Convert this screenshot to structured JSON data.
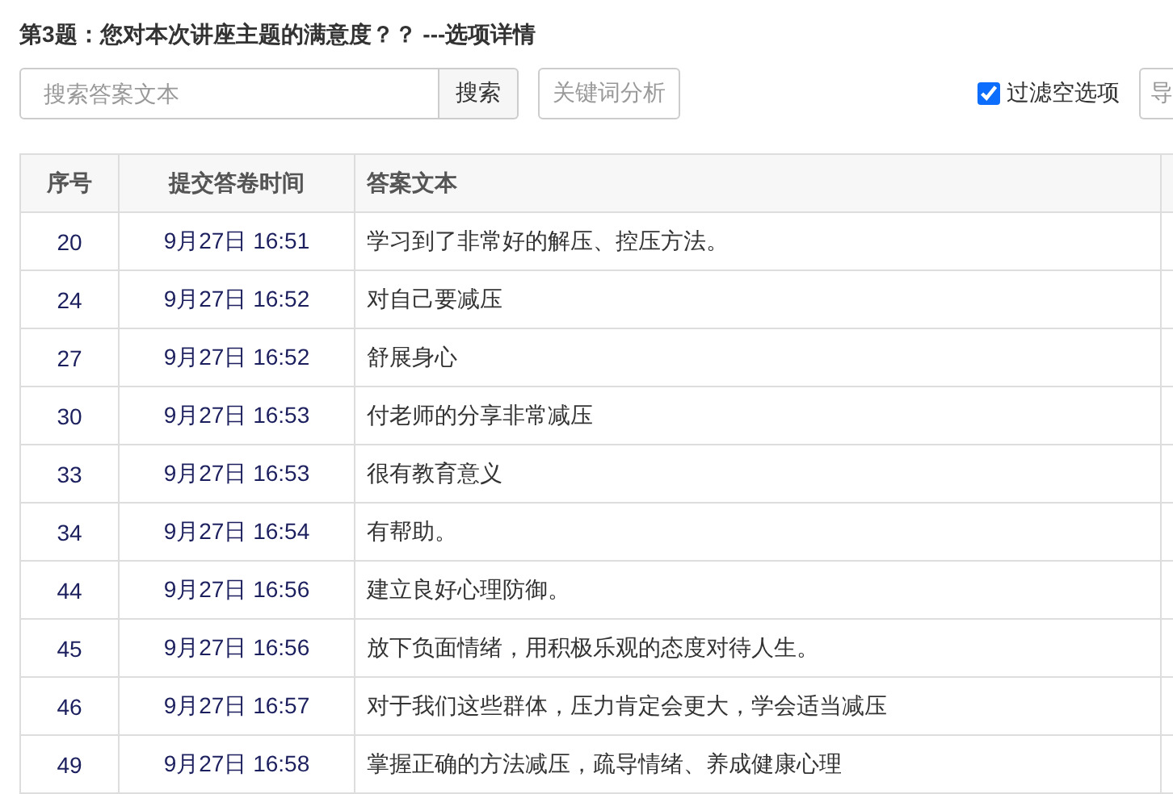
{
  "title": "第3题：您对本次讲座主题的满意度？？ ---选项详情",
  "toolbar": {
    "search": {
      "placeholder": "搜索答案文本"
    },
    "search_button": "搜索",
    "keyword_button": "关键词分析",
    "filter": {
      "label": "过滤空选项",
      "checked": true
    },
    "export_button": "导"
  },
  "table": {
    "columns": [
      "序号",
      "提交答卷时间",
      "答案文本"
    ],
    "rows": [
      {
        "number": "20",
        "time": "9月27日 16:51",
        "answer": "学习到了非常好的解压、控压方法。"
      },
      {
        "number": "24",
        "time": "9月27日 16:52",
        "answer": "对自己要减压"
      },
      {
        "number": "27",
        "time": "9月27日 16:52",
        "answer": "舒展身心"
      },
      {
        "number": "30",
        "time": "9月27日 16:53",
        "answer": "付老师的分享非常减压"
      },
      {
        "number": "33",
        "time": "9月27日 16:53",
        "answer": "很有教育意义"
      },
      {
        "number": "34",
        "time": "9月27日 16:54",
        "answer": "有帮助。"
      },
      {
        "number": "44",
        "time": "9月27日 16:56",
        "answer": "建立良好心理防御。"
      },
      {
        "number": "45",
        "time": "9月27日 16:56",
        "answer": "放下负面情绪，用积极乐观的态度对待人生。"
      },
      {
        "number": "46",
        "time": "9月27日 16:57",
        "answer": "对于我们这些群体，压力肯定会更大，学会适当减压"
      },
      {
        "number": "49",
        "time": "9月27日 16:58",
        "answer": "掌握正确的方法减压，疏导情绪、养成健康心理"
      }
    ]
  }
}
